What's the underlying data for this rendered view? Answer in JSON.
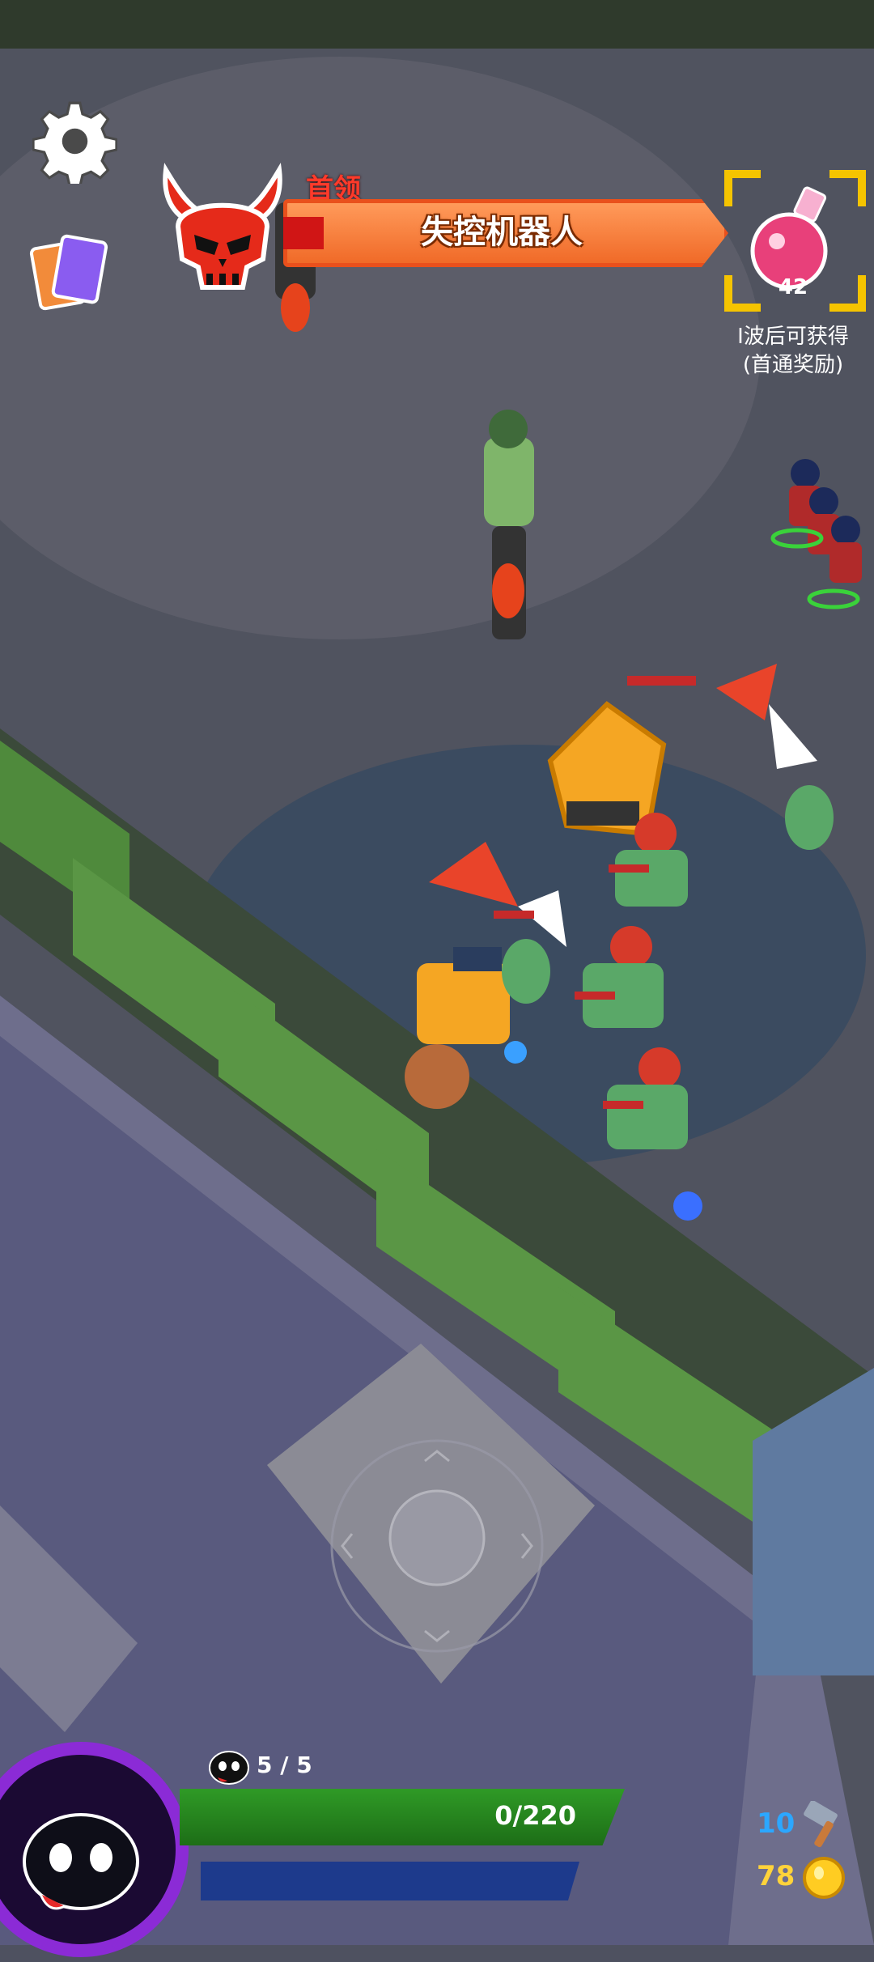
{
  "boss": {
    "tag": "首领",
    "name": "失控机器人"
  },
  "reward": {
    "count": "42",
    "line1": "Ⅰ波后可获得",
    "line2": "(首通奖励)"
  },
  "player": {
    "lives": "5 / 5",
    "xp": "0/220"
  },
  "currency": {
    "hammers": "10",
    "coins": "78"
  },
  "icons": {
    "settings": "gear-icon",
    "cards": "cards-icon",
    "boss": "devil-skull-icon",
    "reward": "potion-icon",
    "hammer": "hammer-icon",
    "coin": "coin-icon"
  },
  "colors": {
    "boss_bar": "#f06a28",
    "boss_tag": "#ff3a2a",
    "xp_bar": "#2f9a26",
    "mana_bar": "#1d3a8c",
    "avatar_ring": "#8b2bd6",
    "hammer_count": "#2ca7ff",
    "coin_count": "#ffd33a"
  }
}
